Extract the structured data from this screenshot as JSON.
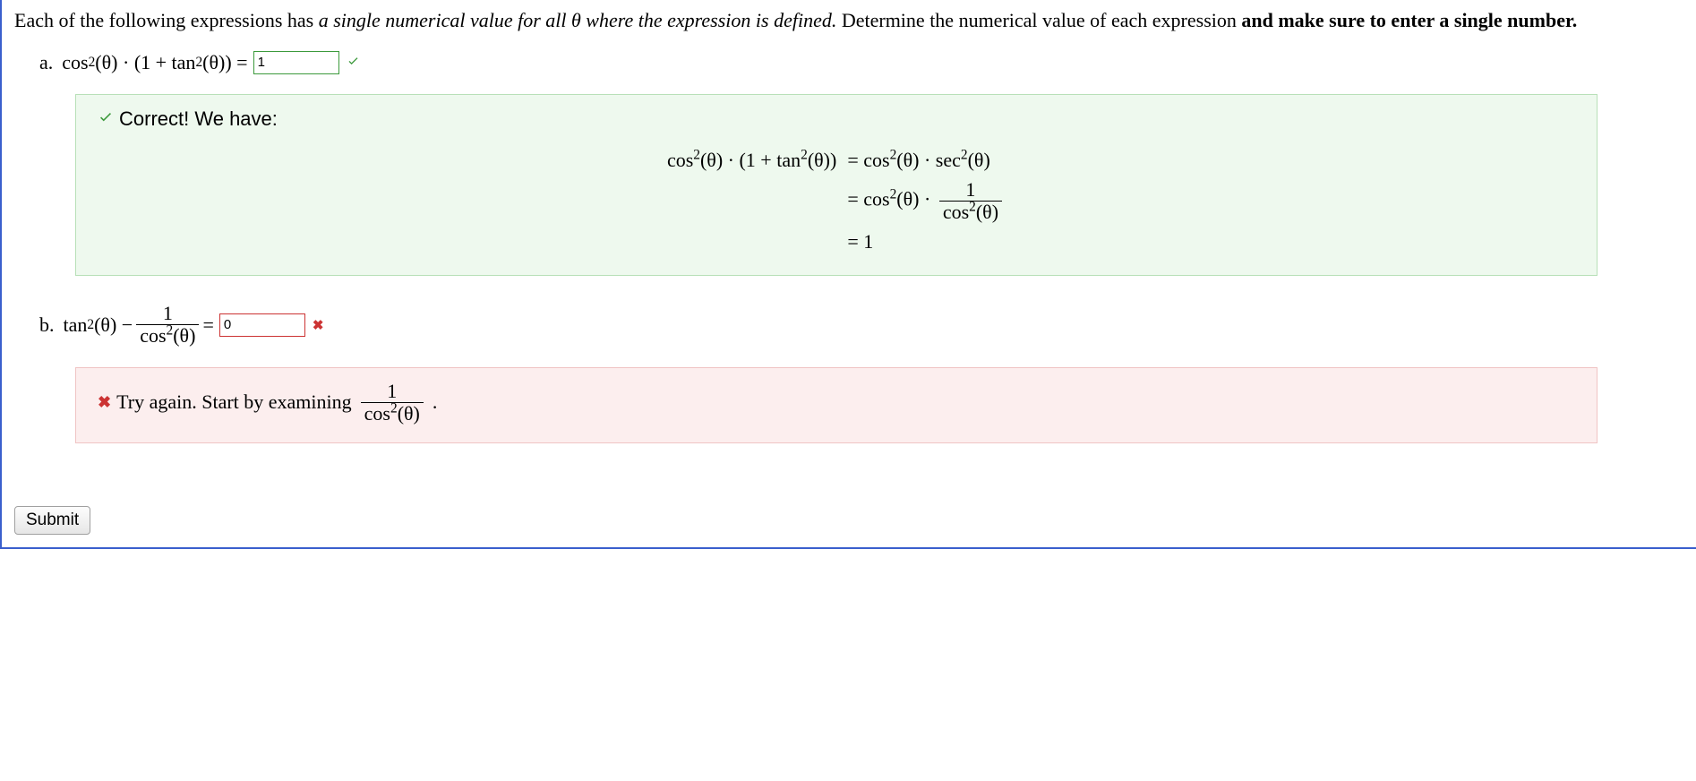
{
  "instructions": {
    "prefix": "Each of the following expressions has ",
    "italic": "a single numerical value for all θ where the expression is defined.",
    "mid": " Determine the numerical value of each expression ",
    "bold": "and make sure to enter a single number.",
    "suffix": ""
  },
  "parts": [
    {
      "label": "a.",
      "expression_html_parts": {
        "p1": "cos",
        "p2": "2",
        "p3": "(θ) · (1 + tan",
        "p4": "2",
        "p5": "(θ))  = "
      },
      "answer_value": "1",
      "status": "correct",
      "feedback": {
        "header_text": "Correct! We have:",
        "derivation": {
          "l1_lhs_p1": "cos",
          "l1_lhs_p2": "2",
          "l1_lhs_p3": "(θ) · (1 + tan",
          "l1_lhs_p4": "2",
          "l1_lhs_p5": "(θ))",
          "l1_rhs_p1": "= cos",
          "l1_rhs_p2": "2",
          "l1_rhs_p3": "(θ) · sec",
          "l1_rhs_p4": "2",
          "l1_rhs_p5": "(θ)",
          "l2_rhs_p1": "= cos",
          "l2_rhs_p2": "2",
          "l2_rhs_p3": "(θ) · ",
          "l2_frac_num": "1",
          "l2_frac_den_p1": "cos",
          "l2_frac_den_p2": "2",
          "l2_frac_den_p3": "(θ)",
          "l3_rhs": "= 1"
        }
      }
    },
    {
      "label": "b.",
      "expression_html_parts": {
        "p1": "tan",
        "p2": "2",
        "p3": "(θ) − ",
        "frac_num": "1",
        "frac_den_p1": "cos",
        "frac_den_p2": "2",
        "frac_den_p3": "(θ)",
        "p_end": "  = "
      },
      "answer_value": "0",
      "status": "incorrect",
      "feedback": {
        "header_text": "Try again. Start by examining",
        "hint_frac_num": "1",
        "hint_frac_den_p1": "cos",
        "hint_frac_den_p2": "2",
        "hint_frac_den_p3": "(θ)",
        "hint_trailer": "."
      }
    }
  ],
  "submit_label": "Submit",
  "icons": {
    "check": "✔",
    "cross": "✖"
  }
}
